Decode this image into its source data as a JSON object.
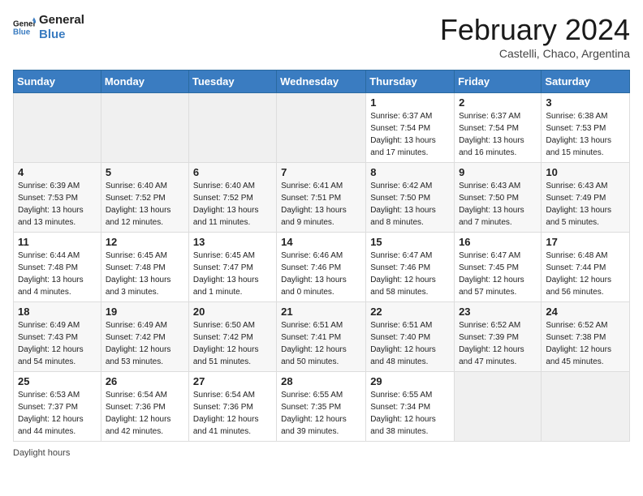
{
  "header": {
    "logo_general": "General",
    "logo_blue": "Blue",
    "month_year": "February 2024",
    "location": "Castelli, Chaco, Argentina"
  },
  "days_of_week": [
    "Sunday",
    "Monday",
    "Tuesday",
    "Wednesday",
    "Thursday",
    "Friday",
    "Saturday"
  ],
  "weeks": [
    [
      {
        "day": "",
        "detail": ""
      },
      {
        "day": "",
        "detail": ""
      },
      {
        "day": "",
        "detail": ""
      },
      {
        "day": "",
        "detail": ""
      },
      {
        "day": "1",
        "detail": "Sunrise: 6:37 AM\nSunset: 7:54 PM\nDaylight: 13 hours\nand 17 minutes."
      },
      {
        "day": "2",
        "detail": "Sunrise: 6:37 AM\nSunset: 7:54 PM\nDaylight: 13 hours\nand 16 minutes."
      },
      {
        "day": "3",
        "detail": "Sunrise: 6:38 AM\nSunset: 7:53 PM\nDaylight: 13 hours\nand 15 minutes."
      }
    ],
    [
      {
        "day": "4",
        "detail": "Sunrise: 6:39 AM\nSunset: 7:53 PM\nDaylight: 13 hours\nand 13 minutes."
      },
      {
        "day": "5",
        "detail": "Sunrise: 6:40 AM\nSunset: 7:52 PM\nDaylight: 13 hours\nand 12 minutes."
      },
      {
        "day": "6",
        "detail": "Sunrise: 6:40 AM\nSunset: 7:52 PM\nDaylight: 13 hours\nand 11 minutes."
      },
      {
        "day": "7",
        "detail": "Sunrise: 6:41 AM\nSunset: 7:51 PM\nDaylight: 13 hours\nand 9 minutes."
      },
      {
        "day": "8",
        "detail": "Sunrise: 6:42 AM\nSunset: 7:50 PM\nDaylight: 13 hours\nand 8 minutes."
      },
      {
        "day": "9",
        "detail": "Sunrise: 6:43 AM\nSunset: 7:50 PM\nDaylight: 13 hours\nand 7 minutes."
      },
      {
        "day": "10",
        "detail": "Sunrise: 6:43 AM\nSunset: 7:49 PM\nDaylight: 13 hours\nand 5 minutes."
      }
    ],
    [
      {
        "day": "11",
        "detail": "Sunrise: 6:44 AM\nSunset: 7:48 PM\nDaylight: 13 hours\nand 4 minutes."
      },
      {
        "day": "12",
        "detail": "Sunrise: 6:45 AM\nSunset: 7:48 PM\nDaylight: 13 hours\nand 3 minutes."
      },
      {
        "day": "13",
        "detail": "Sunrise: 6:45 AM\nSunset: 7:47 PM\nDaylight: 13 hours\nand 1 minute."
      },
      {
        "day": "14",
        "detail": "Sunrise: 6:46 AM\nSunset: 7:46 PM\nDaylight: 13 hours\nand 0 minutes."
      },
      {
        "day": "15",
        "detail": "Sunrise: 6:47 AM\nSunset: 7:46 PM\nDaylight: 12 hours\nand 58 minutes."
      },
      {
        "day": "16",
        "detail": "Sunrise: 6:47 AM\nSunset: 7:45 PM\nDaylight: 12 hours\nand 57 minutes."
      },
      {
        "day": "17",
        "detail": "Sunrise: 6:48 AM\nSunset: 7:44 PM\nDaylight: 12 hours\nand 56 minutes."
      }
    ],
    [
      {
        "day": "18",
        "detail": "Sunrise: 6:49 AM\nSunset: 7:43 PM\nDaylight: 12 hours\nand 54 minutes."
      },
      {
        "day": "19",
        "detail": "Sunrise: 6:49 AM\nSunset: 7:42 PM\nDaylight: 12 hours\nand 53 minutes."
      },
      {
        "day": "20",
        "detail": "Sunrise: 6:50 AM\nSunset: 7:42 PM\nDaylight: 12 hours\nand 51 minutes."
      },
      {
        "day": "21",
        "detail": "Sunrise: 6:51 AM\nSunset: 7:41 PM\nDaylight: 12 hours\nand 50 minutes."
      },
      {
        "day": "22",
        "detail": "Sunrise: 6:51 AM\nSunset: 7:40 PM\nDaylight: 12 hours\nand 48 minutes."
      },
      {
        "day": "23",
        "detail": "Sunrise: 6:52 AM\nSunset: 7:39 PM\nDaylight: 12 hours\nand 47 minutes."
      },
      {
        "day": "24",
        "detail": "Sunrise: 6:52 AM\nSunset: 7:38 PM\nDaylight: 12 hours\nand 45 minutes."
      }
    ],
    [
      {
        "day": "25",
        "detail": "Sunrise: 6:53 AM\nSunset: 7:37 PM\nDaylight: 12 hours\nand 44 minutes."
      },
      {
        "day": "26",
        "detail": "Sunrise: 6:54 AM\nSunset: 7:36 PM\nDaylight: 12 hours\nand 42 minutes."
      },
      {
        "day": "27",
        "detail": "Sunrise: 6:54 AM\nSunset: 7:36 PM\nDaylight: 12 hours\nand 41 minutes."
      },
      {
        "day": "28",
        "detail": "Sunrise: 6:55 AM\nSunset: 7:35 PM\nDaylight: 12 hours\nand 39 minutes."
      },
      {
        "day": "29",
        "detail": "Sunrise: 6:55 AM\nSunset: 7:34 PM\nDaylight: 12 hours\nand 38 minutes."
      },
      {
        "day": "",
        "detail": ""
      },
      {
        "day": "",
        "detail": ""
      }
    ]
  ],
  "footer": {
    "daylight_label": "Daylight hours"
  }
}
